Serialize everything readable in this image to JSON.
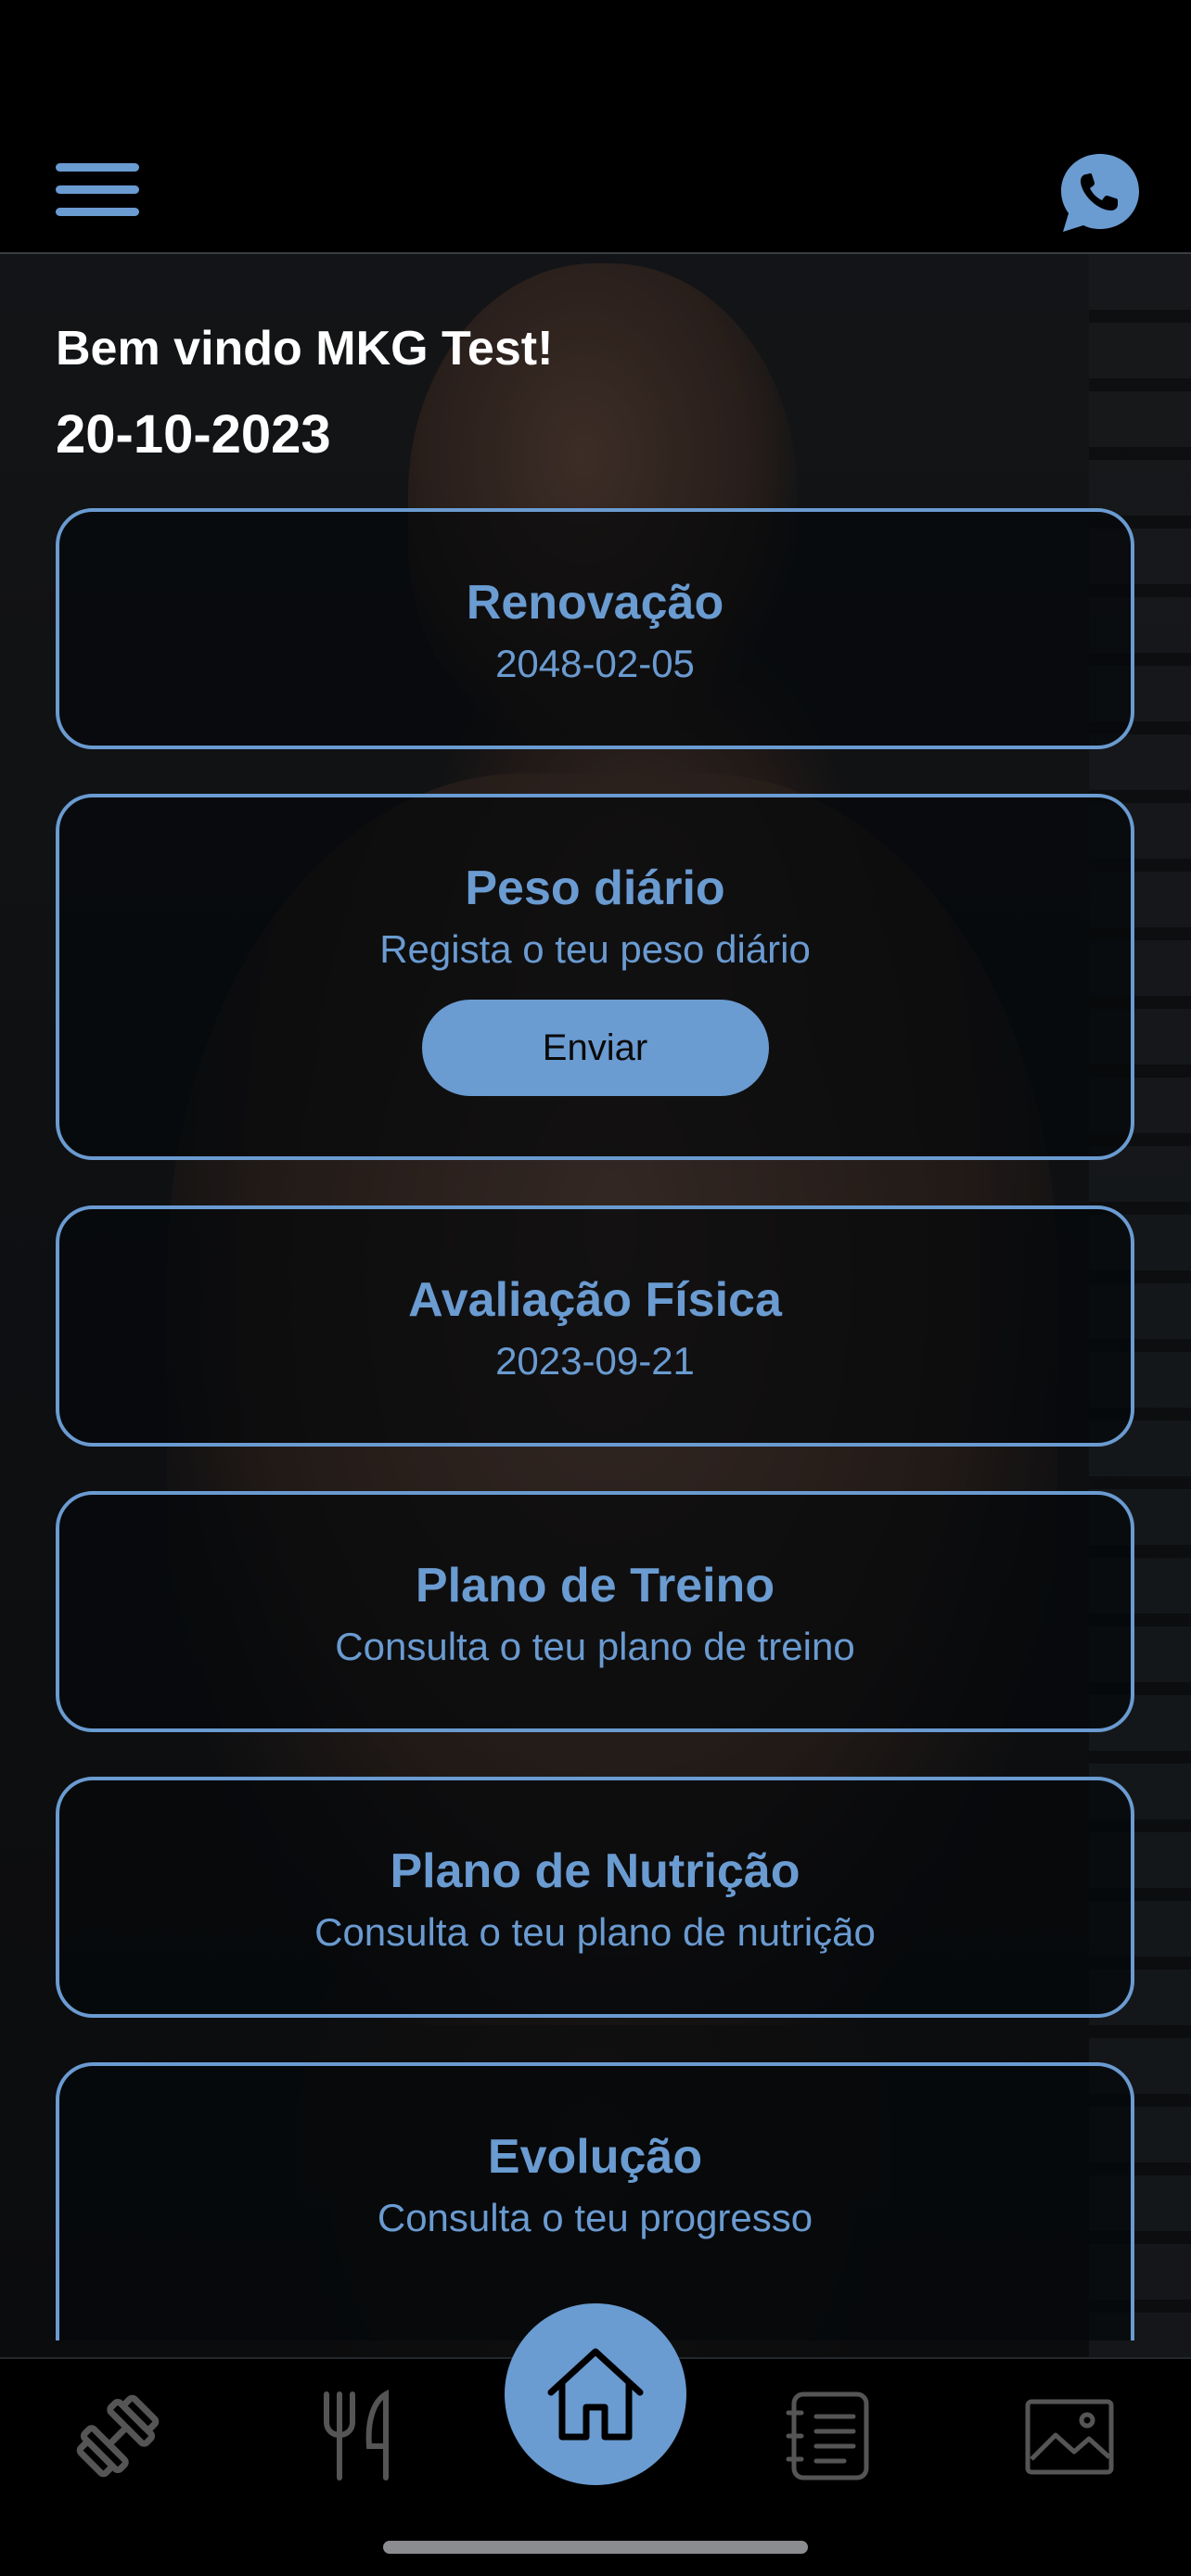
{
  "header": {
    "menu_icon": "hamburger-menu-icon",
    "whatsapp_icon": "whatsapp-icon"
  },
  "welcome": {
    "greeting": "Bem vindo MKG Test!",
    "date": "20-10-2023"
  },
  "cards": [
    {
      "title": "Renovação",
      "subtitle": "2048-02-05"
    },
    {
      "title": "Peso diário",
      "subtitle": "Regista o teu peso diário",
      "button": "Enviar"
    },
    {
      "title": "Avaliação Física",
      "subtitle": "2023-09-21"
    },
    {
      "title": "Plano de Treino",
      "subtitle": "Consulta o teu plano de treino"
    },
    {
      "title": "Plano de Nutrição",
      "subtitle": "Consulta o teu plano de nutrição"
    },
    {
      "title": "Evolução",
      "subtitle": "Consulta o teu progresso"
    }
  ],
  "bottom_nav": {
    "items": [
      {
        "icon": "dumbbell-icon"
      },
      {
        "icon": "fork-knife-icon"
      },
      {
        "icon": "home-icon",
        "active": true
      },
      {
        "icon": "checklist-icon"
      },
      {
        "icon": "gallery-icon"
      }
    ]
  },
  "colors": {
    "accent": "#6a9bd1",
    "background": "#000000",
    "text": "#ffffff",
    "inactive_icon": "#555555"
  }
}
